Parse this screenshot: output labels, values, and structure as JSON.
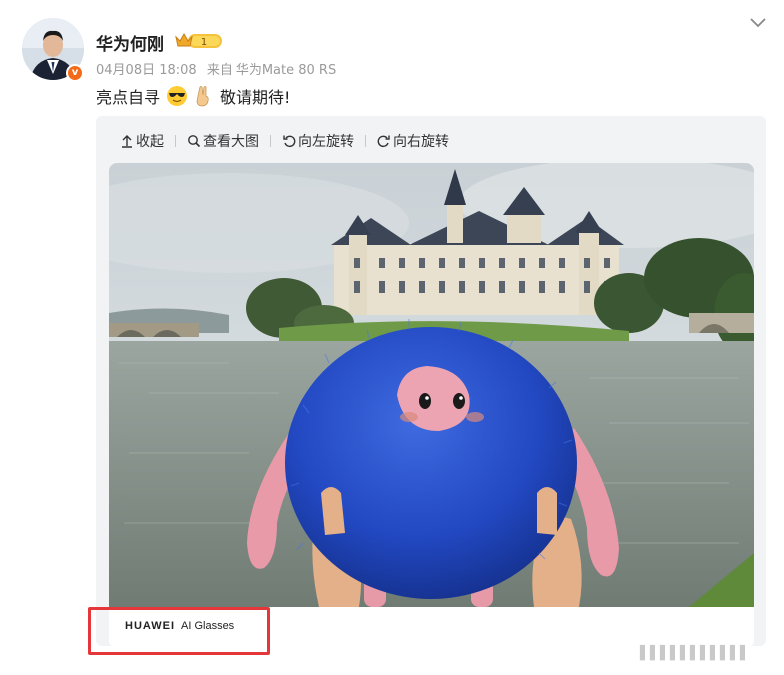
{
  "author": {
    "name": "华为何刚",
    "verified_badge": "v",
    "level": "1"
  },
  "post": {
    "date": "04月08日 18:08",
    "source_prefix": "来自",
    "source": "华为Mate 80 RS",
    "text_before": "亮点自寻",
    "text_after": "敬请期待!",
    "emojis": [
      "sunglasses-emoji",
      "victory-hand-emoji"
    ]
  },
  "toolbar": {
    "collapse": "收起",
    "view_large": "查看大图",
    "rotate_left": "向左旋转",
    "rotate_right": "向右旋转"
  },
  "photo_caption": {
    "brand": "HUAWEI",
    "product": "AI Glasses"
  },
  "watermark": "▌▌▌▌▌▌▌▌▌▌▌",
  "colors": {
    "highlight": "#e5363a",
    "verified": "#f36b18",
    "crown": "#f5c33b"
  }
}
